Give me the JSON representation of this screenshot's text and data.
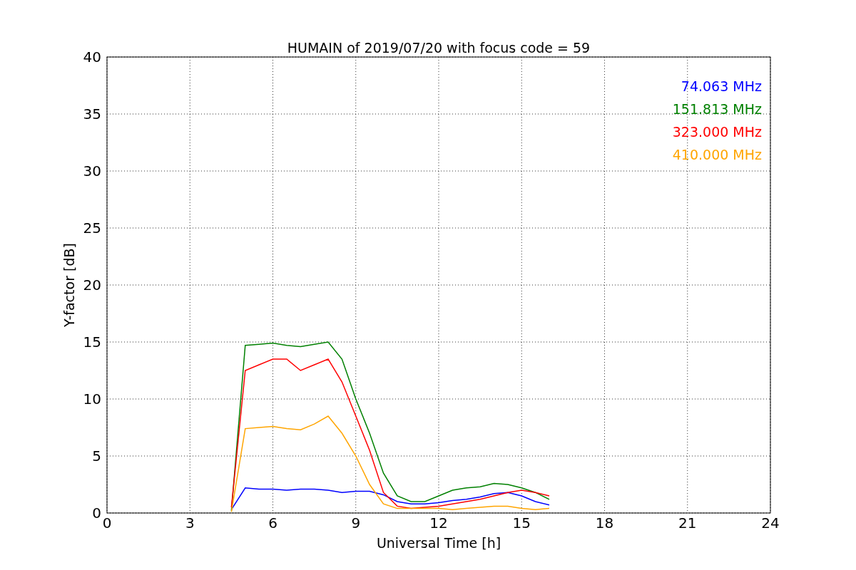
{
  "figure": {
    "chart_data": {
      "type": "line",
      "title": "HUMAIN of 2019/07/20 with focus code = 59",
      "xlabel": "Universal Time [h]",
      "ylabel": "Y-factor [dB]",
      "x": [
        4.5,
        5,
        5.5,
        6,
        6.5,
        7,
        7.5,
        8,
        8.5,
        9,
        9.5,
        10,
        10.5,
        11,
        11.5,
        12,
        12.5,
        13,
        13.5,
        14,
        14.5,
        15,
        15.5,
        16
      ],
      "series": [
        {
          "name": "74.063 MHz",
          "color": "#0000ff",
          "values": [
            0.3,
            2.2,
            2.1,
            2.1,
            2.0,
            2.1,
            2.1,
            2.0,
            1.8,
            1.9,
            1.9,
            1.6,
            1.0,
            0.8,
            0.8,
            0.9,
            1.1,
            1.2,
            1.4,
            1.7,
            1.8,
            1.5,
            1.0,
            0.7
          ]
        },
        {
          "name": "151.813 MHz",
          "color": "#008000",
          "values": [
            0.2,
            14.7,
            14.8,
            14.9,
            14.7,
            14.6,
            14.8,
            15.0,
            13.5,
            10.0,
            7.0,
            3.5,
            1.5,
            1.0,
            1.0,
            1.5,
            2.0,
            2.2,
            2.3,
            2.6,
            2.5,
            2.2,
            1.8,
            1.2
          ]
        },
        {
          "name": "323.000 MHz",
          "color": "#ff0000",
          "values": [
            0.5,
            12.5,
            13.0,
            13.5,
            13.5,
            12.5,
            13.0,
            13.5,
            11.5,
            8.5,
            5.5,
            1.8,
            0.6,
            0.4,
            0.5,
            0.6,
            0.8,
            1.0,
            1.2,
            1.5,
            1.8,
            2.0,
            1.8,
            1.5
          ]
        },
        {
          "name": "410.000 MHz",
          "color": "#ffa500",
          "values": [
            0.1,
            7.4,
            7.5,
            7.6,
            7.4,
            7.3,
            7.8,
            8.5,
            7.0,
            5.0,
            2.5,
            0.8,
            0.4,
            0.4,
            0.4,
            0.4,
            0.3,
            0.4,
            0.5,
            0.6,
            0.6,
            0.4,
            0.3,
            0.4
          ]
        }
      ],
      "xlim": [
        0,
        24
      ],
      "ylim": [
        0,
        40
      ],
      "xticks": [
        0,
        3,
        6,
        9,
        12,
        15,
        18,
        21,
        24
      ],
      "yticks": [
        0,
        5,
        10,
        15,
        20,
        25,
        30,
        35,
        40
      ],
      "grid": true
    }
  }
}
